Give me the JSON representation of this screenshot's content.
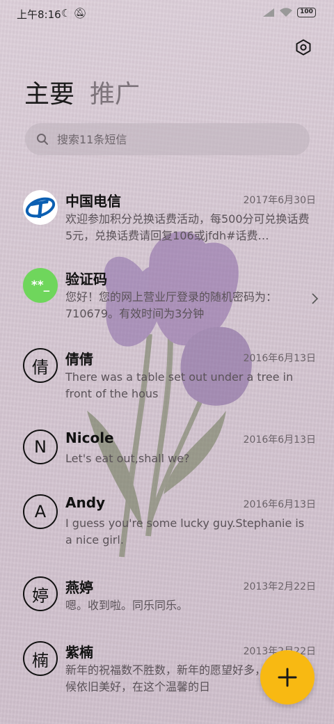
{
  "status_bar": {
    "time": "上午8:16",
    "battery": "100",
    "icons": [
      "moon-icon",
      "mute-icon",
      "signal-icon",
      "wifi-icon",
      "battery-icon"
    ]
  },
  "header": {
    "tabs": [
      {
        "label": "主要",
        "active": true
      },
      {
        "label": "推广",
        "active": false
      }
    ]
  },
  "search": {
    "placeholder": "搜索11条短信"
  },
  "messages": [
    {
      "name": "中国电信",
      "date": "2017年6月30日",
      "preview": "欢迎参加积分兑换话费活动，每500分可兑换话费5元，兑换话费请回复106或jfdh#话费…",
      "avatar_type": "logo",
      "avatar_icon": "china-telecom-logo"
    },
    {
      "name": "验证码",
      "date": "",
      "preview": "您好！您的网上营业厅登录的随机密码为：710679。有效时间为3分钟",
      "avatar_type": "code",
      "avatar_text": "**_",
      "avatar_color": "#6fd65c"
    },
    {
      "name": "倩倩",
      "date": "2016年6月13日",
      "preview": "There was a table set out under a tree in front of the hous",
      "avatar_type": "letter",
      "avatar_text": "倩"
    },
    {
      "name": "Nicole",
      "date": "2016年6月13日",
      "preview": "Let's eat out,shall we?",
      "avatar_type": "letter",
      "avatar_text": "N"
    },
    {
      "name": "Andy",
      "date": "2016年6月13日",
      "preview": "I guess you're some lucky guy.Stephanie is a nice girl.",
      "avatar_type": "letter",
      "avatar_text": "A"
    },
    {
      "name": "燕婷",
      "date": "2013年2月22日",
      "preview": "嗯。收到啦。同乐同乐。",
      "avatar_type": "letter",
      "avatar_text": "婷"
    },
    {
      "name": "紫楠",
      "date": "2013年2月22日",
      "preview": "新年的祝福数不胜数，新年的愿望好多，新年的问候依旧美好，在这个温馨的日",
      "avatar_type": "letter",
      "avatar_text": "楠"
    }
  ],
  "colors": {
    "fab": "#f8b912",
    "code_avatar": "#6fd65c",
    "telecom_blue": "#0b5fb2"
  }
}
